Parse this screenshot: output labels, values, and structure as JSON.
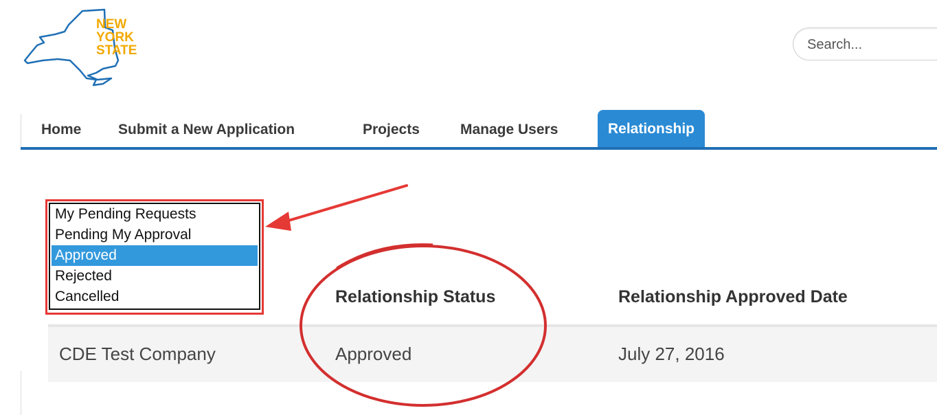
{
  "header": {
    "logo": {
      "line1": "NEW",
      "line2": "YORK",
      "line3": "STATE"
    },
    "search": {
      "placeholder": "Search..."
    }
  },
  "nav": {
    "tabs": [
      {
        "label": "Home"
      },
      {
        "label": "Submit a New Application"
      },
      {
        "label": "Projects"
      },
      {
        "label": "Manage Users"
      },
      {
        "label": "Relationship",
        "active": true
      }
    ]
  },
  "filter": {
    "options": [
      "My Pending Requests",
      "Pending My Approval",
      "Approved",
      "Rejected",
      "Cancelled"
    ],
    "selected": "Approved"
  },
  "table": {
    "columns": [
      "Relationship Status",
      "Relationship Approved Date"
    ],
    "rows": [
      {
        "company": "CDE Test Company",
        "status": "Approved",
        "date": "July 27, 2016"
      }
    ]
  },
  "colors": {
    "accent": "#2a8ad4",
    "nav_rule": "#1f6fb5",
    "logo_gold": "#f2a900",
    "annotation_red": "#e53935"
  }
}
